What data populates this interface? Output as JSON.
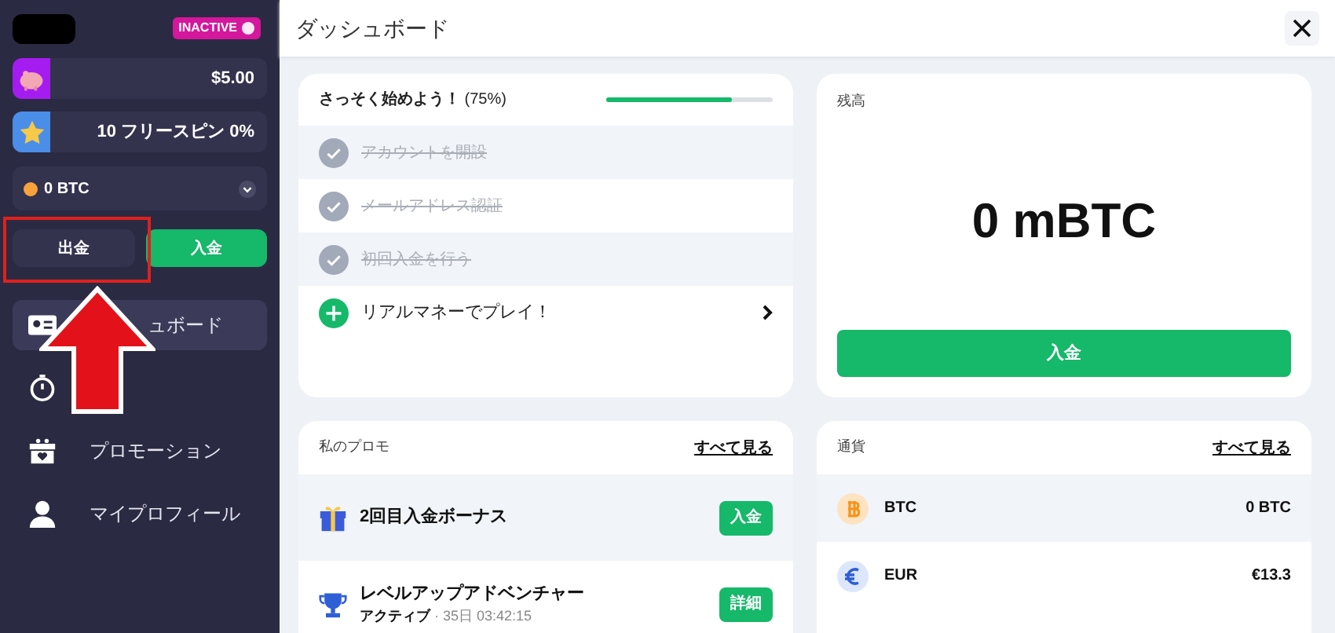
{
  "sidebar": {
    "status_badge": "INACTIVE",
    "wallet_rows": [
      {
        "kind": "piggy",
        "value": "$5.00"
      },
      {
        "kind": "star",
        "value": "10 フリースピン 0%"
      }
    ],
    "currency_select": {
      "value": "0 BTC"
    },
    "buttons": [
      {
        "label": "出金",
        "kind": "withdraw"
      },
      {
        "label": "入金",
        "kind": "deposit"
      }
    ],
    "nav": [
      {
        "kind": "card",
        "label": "ュボード",
        "selected": true
      },
      {
        "kind": "timer",
        "selected": false
      },
      {
        "kind": "gift",
        "label": "プロモーション",
        "selected": false
      },
      {
        "kind": "user",
        "label": "マイプロフィール",
        "selected": false
      }
    ]
  },
  "header": {
    "title": "ダッシュボード"
  },
  "checklist": {
    "title": "さっそく始めよう！",
    "percent": "(75%)",
    "level": 0.75,
    "items": [
      {
        "label": "アカウントを開設",
        "done": true
      },
      {
        "label": "メールアドレス認証",
        "done": true
      },
      {
        "label": "初回入金を行う",
        "done": true
      },
      {
        "label": "リアルマネーでプレイ！",
        "done": false
      }
    ]
  },
  "balance": {
    "title": "残高",
    "amount": "0 mBTC",
    "button": "入金"
  },
  "promos": {
    "title": "私のプロモ",
    "link": "すべて見る",
    "items": [
      {
        "kind": "gift",
        "name": "2回目入金ボーナス",
        "button": "入金"
      },
      {
        "kind": "trophy",
        "name": "レベルアップアドベンチャー",
        "status": "アクティブ",
        "timer": "· 35日 03:42:15",
        "button": "詳細"
      }
    ]
  },
  "currencies": {
    "title": "通貨",
    "link": "すべて見る",
    "items": [
      {
        "kind": "btc",
        "code": "BTC",
        "amount": "0 BTC"
      },
      {
        "kind": "eur",
        "code": "EUR",
        "amount": "€13.3"
      }
    ]
  }
}
